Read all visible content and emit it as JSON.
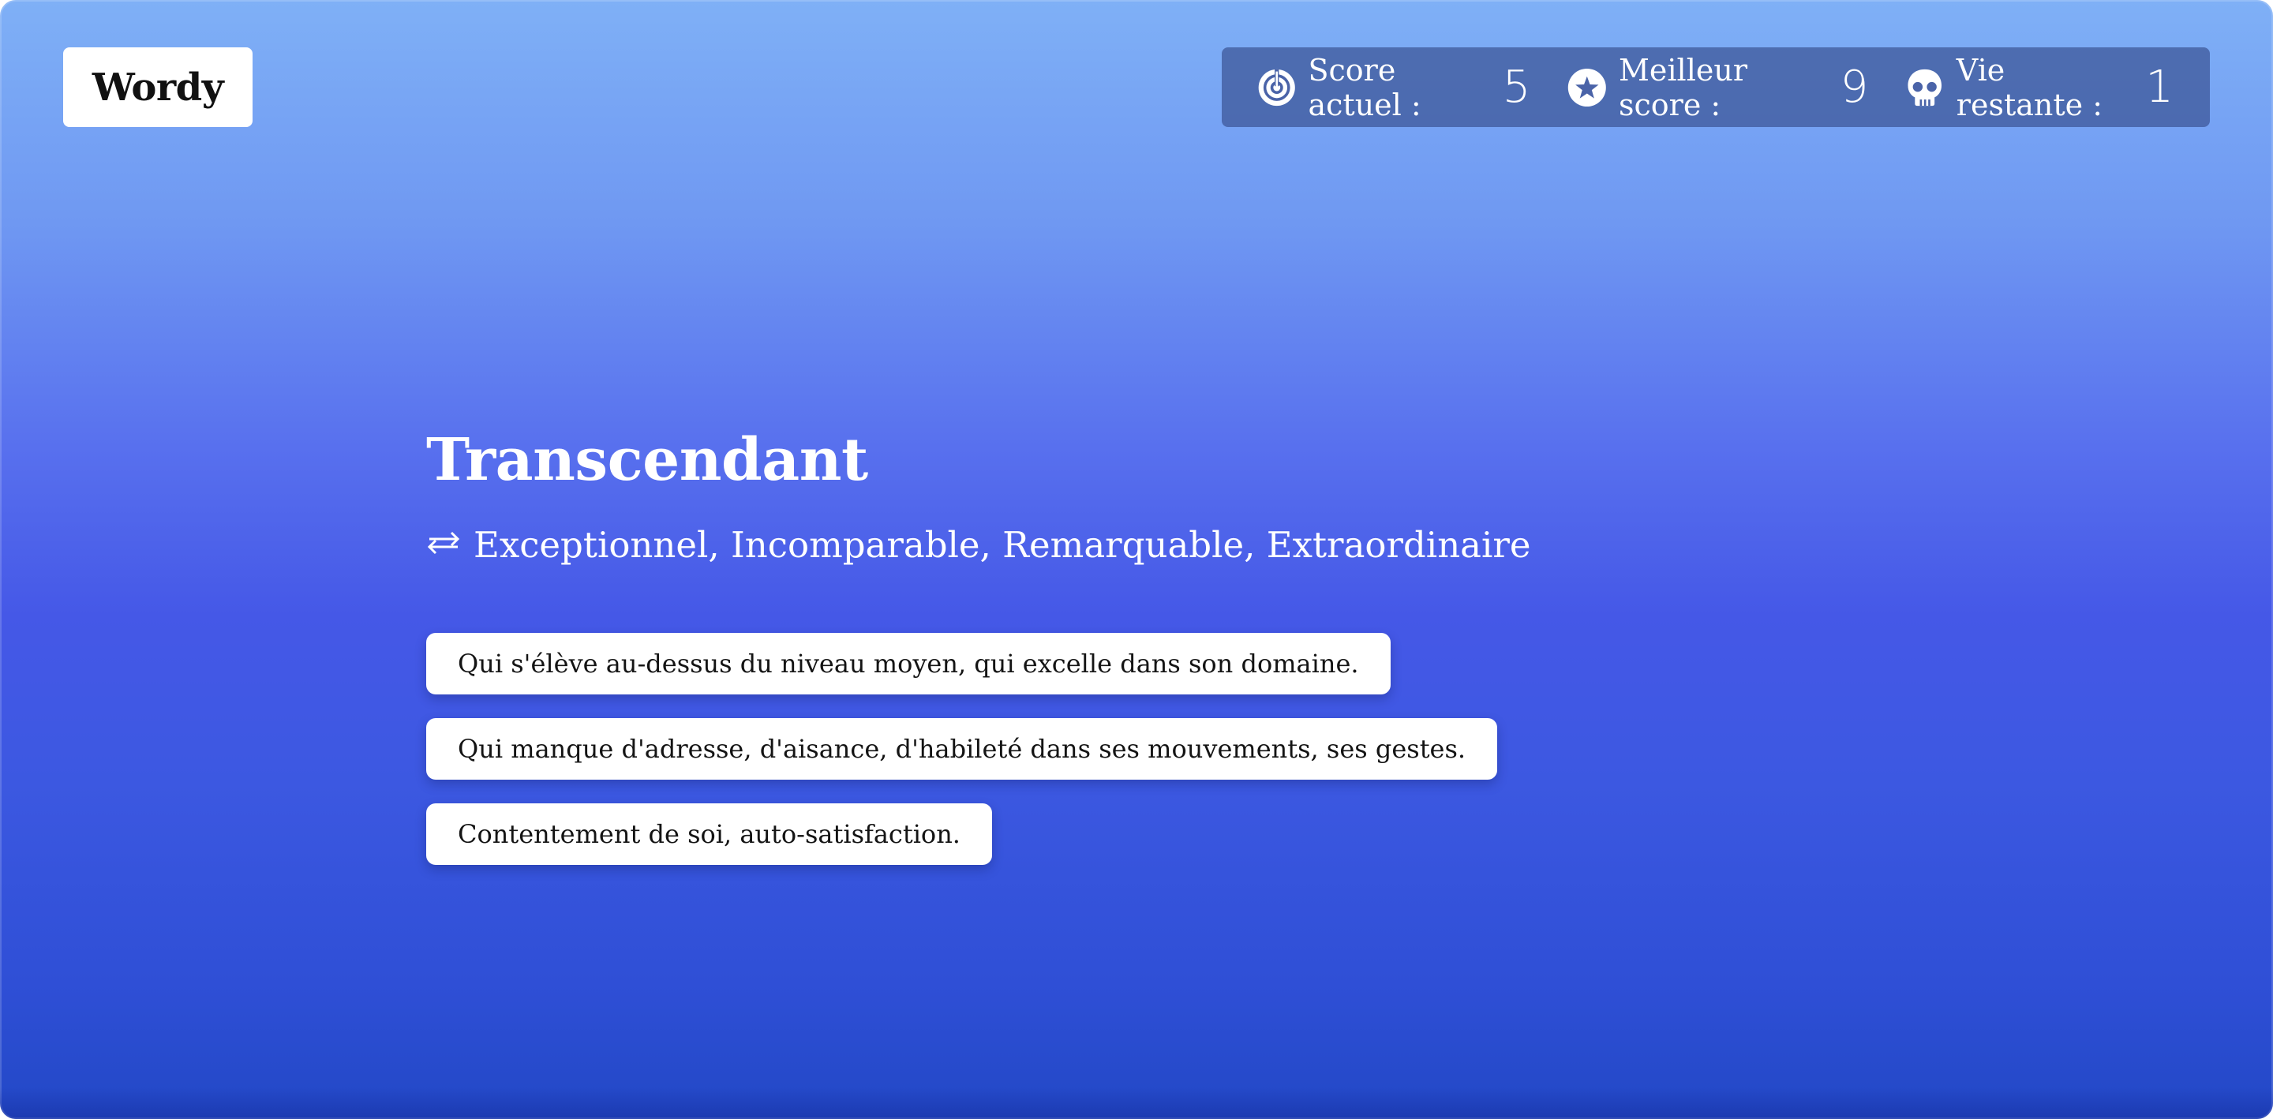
{
  "app": {
    "logo_text": "Wordy"
  },
  "stats": {
    "current": {
      "label": "Score actuel :",
      "value": "5",
      "icon": "target-icon"
    },
    "best": {
      "label": "Meilleur score :",
      "value": "9",
      "icon": "star-icon"
    },
    "lives": {
      "label": "Vie restante :",
      "value": "1",
      "icon": "skull-icon"
    }
  },
  "question": {
    "word": "Transcendant",
    "synonyms": "Exceptionnel, Incomparable, Remarquable, Extraordinaire",
    "synonyms_icon": "swap-arrows-icon"
  },
  "options": [
    "Qui s'élève au-dessus du niveau moyen, qui excelle dans son domaine.",
    "Qui manque d'adresse, d'aisance, d'habileté dans ses mouvements, ses gestes.",
    "Contentement de soi, auto-satisfaction."
  ],
  "colors": {
    "background_top": "#7fb0f6",
    "background_bottom": "#2248c6",
    "scorebar": "#3c5596",
    "card": "#ffffff"
  }
}
